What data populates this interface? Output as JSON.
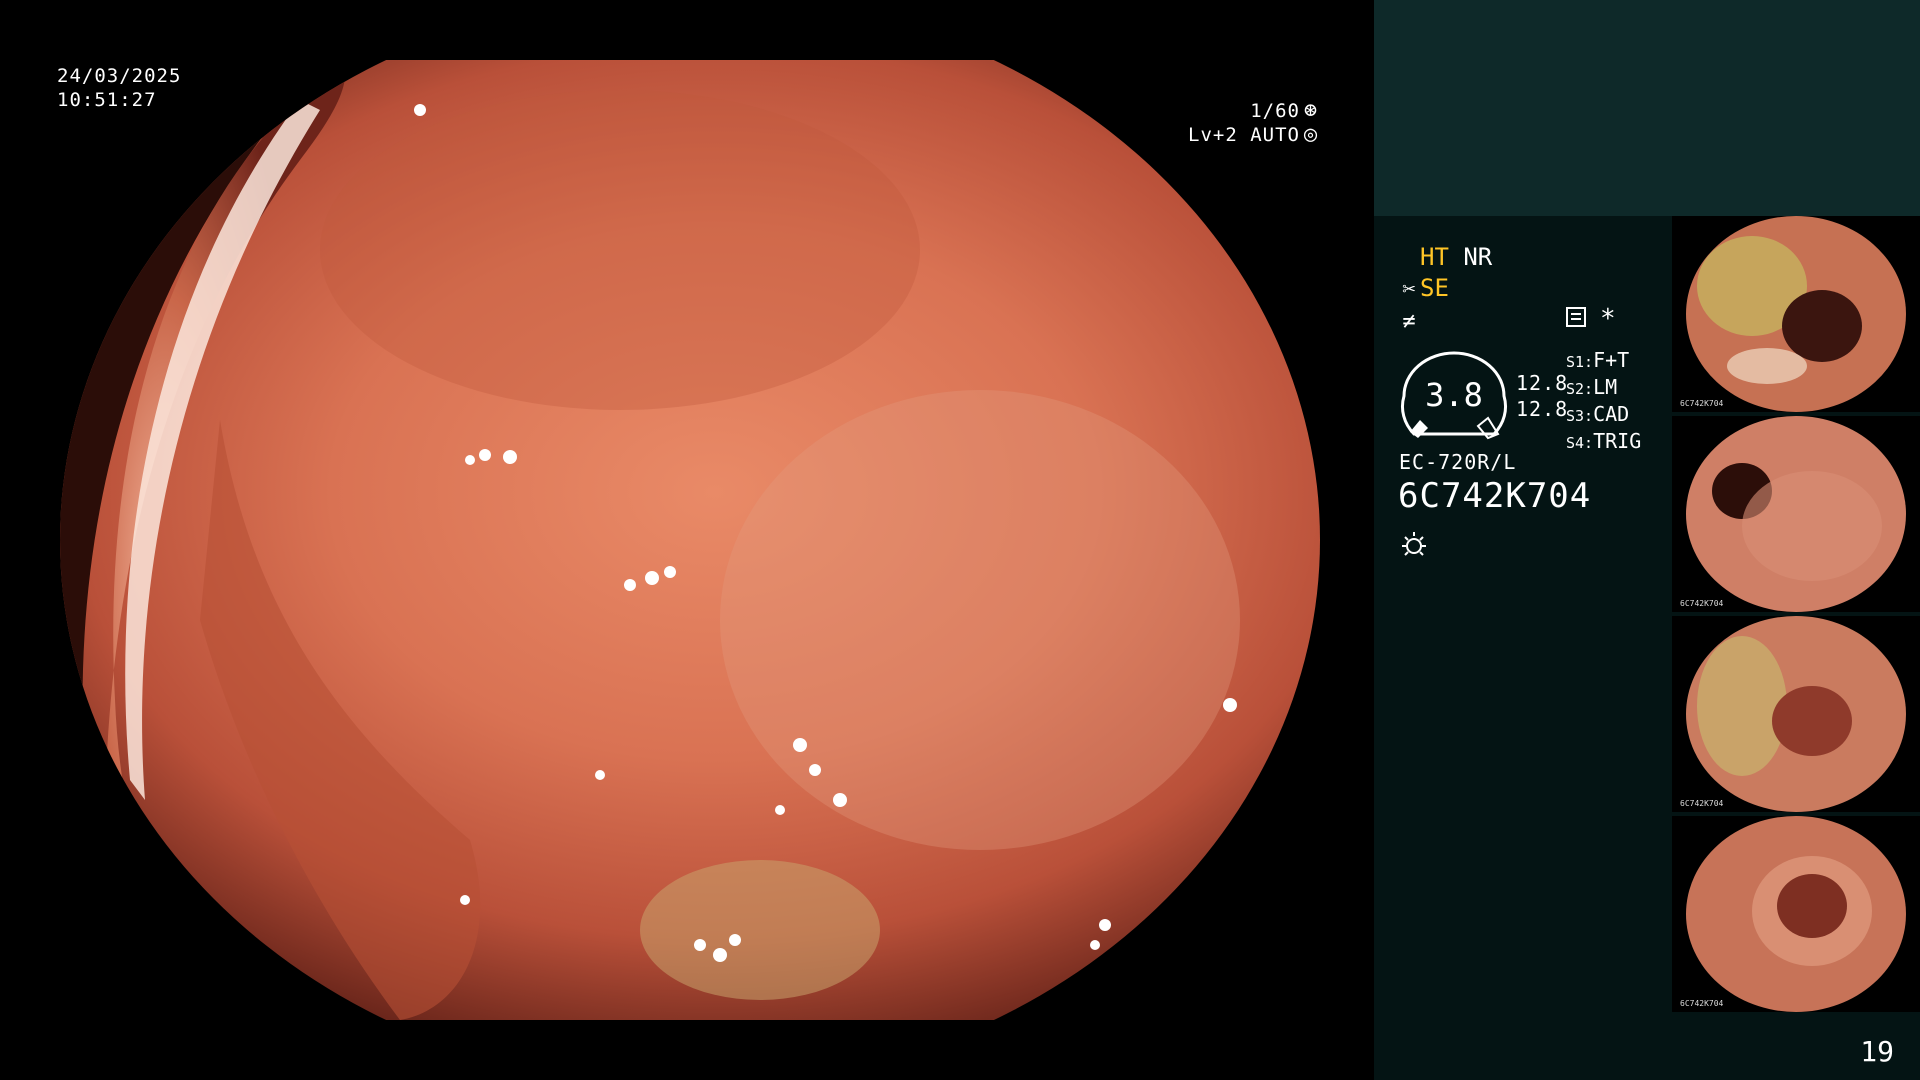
{
  "overlay": {
    "date": "24/03/2025",
    "time": "10:51:27",
    "shutter": "1/60",
    "level": "Lv+2 AUTO"
  },
  "panel": {
    "mode_primary": "HT",
    "mode_secondary": "NR",
    "se_label": "SE",
    "meter_value": "3.8",
    "meter_value_a": "12.8",
    "meter_value_b": "12.8",
    "settings": [
      {
        "key": "S1:",
        "value": "F+T"
      },
      {
        "key": "S2:",
        "value": "LM"
      },
      {
        "key": "S3:",
        "value": "CAD"
      },
      {
        "key": "S4:",
        "value": "TRIG"
      }
    ],
    "scope_model": "EC-720R/L",
    "serial": "6C742K704",
    "star": "*",
    "page_number": "19"
  },
  "thumbnails": [
    {
      "label": "6C742K704"
    },
    {
      "label": "6C742K704"
    },
    {
      "label": "6C742K704"
    },
    {
      "label": "6C742K704"
    }
  ],
  "colors": {
    "yellow_text": "#ffc526",
    "panel_bg": "#041414",
    "panel_top_bg": "#0e2929",
    "mucosa": "#d26a4d"
  },
  "icons": [
    "shutter-icon",
    "auto-icon",
    "scissors-icon",
    "filter-icon",
    "mode-icon",
    "light-icon"
  ]
}
